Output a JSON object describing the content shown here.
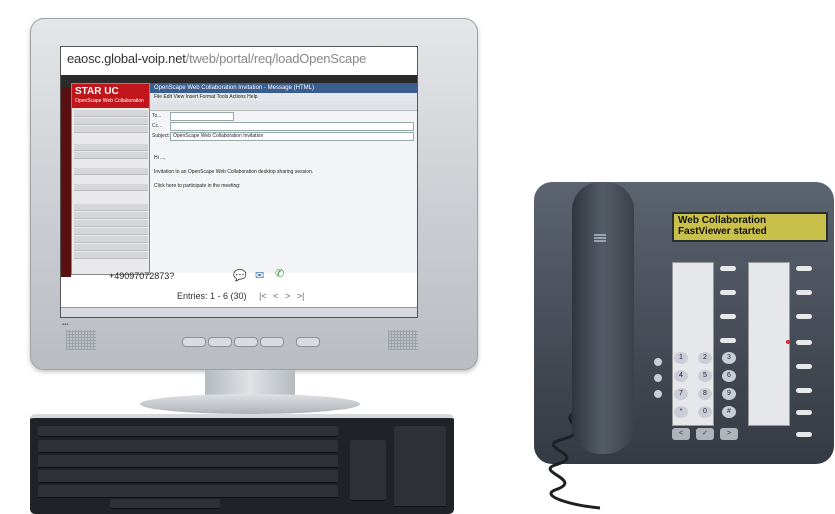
{
  "browser": {
    "url_host": "eaosc.global-voip.net",
    "url_path": "/tweb/portal/req/loadOpenScape"
  },
  "sidebar": {
    "title": "STAR UC",
    "subtitle": "OpenScape Web Collaboration"
  },
  "mail_window": {
    "title": "OpenScape Web Collaboration Invitation - Message (HTML)",
    "menu": "File  Edit  View  Insert  Format  Tools  Actions  Help",
    "to_label": "To...",
    "cc_label": "Cc...",
    "subject_label": "Subject:",
    "subject_value": "OpenScape Web Collaboration Invitation",
    "greeting": "Hi ...,",
    "line1": "Invitation to an OpenScape Web Collaboration desktop sharing session.",
    "line2": "Click here to participate in the meeting:"
  },
  "contact": {
    "phone_number": "+49097072873?"
  },
  "pager": {
    "entries_text": "Entries: 1 - 6 (30)",
    "nav": [
      "|<",
      "<",
      ">",
      ">|"
    ]
  },
  "phone_display": {
    "line1": "Web Collaboration",
    "line2": "FastViewer started"
  },
  "keypad": [
    "1",
    "2",
    "3",
    "4",
    "5",
    "6",
    "7",
    "8",
    "9",
    "*",
    "0",
    "#"
  ],
  "nav_keys": [
    "<",
    "✓",
    ">"
  ],
  "colors": {
    "brand_red": "#c0151a",
    "lcd": "#c8c04a",
    "phone_body": "#454c56"
  }
}
